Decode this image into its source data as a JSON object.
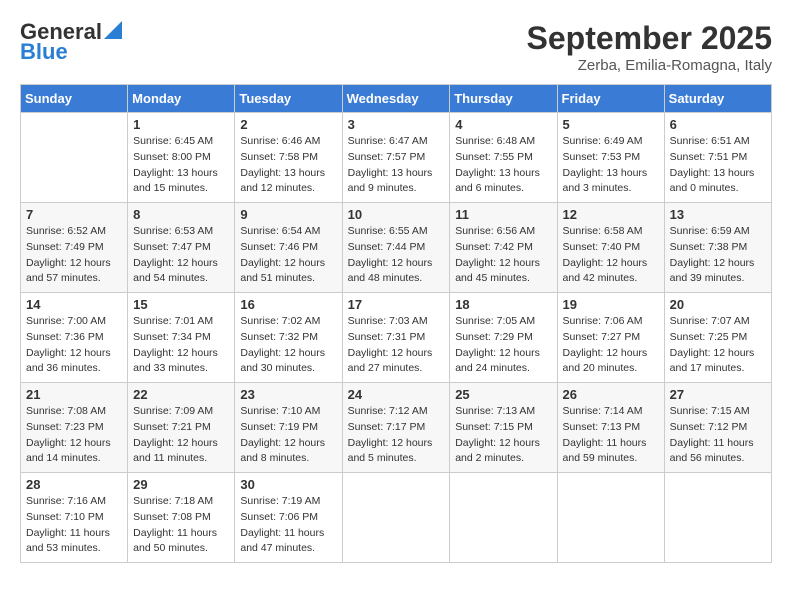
{
  "logo": {
    "general": "General",
    "blue": "Blue"
  },
  "title": {
    "month_year": "September 2025",
    "location": "Zerba, Emilia-Romagna, Italy"
  },
  "headers": [
    "Sunday",
    "Monday",
    "Tuesday",
    "Wednesday",
    "Thursday",
    "Friday",
    "Saturday"
  ],
  "weeks": [
    [
      {
        "day": "",
        "info": ""
      },
      {
        "day": "1",
        "info": "Sunrise: 6:45 AM\nSunset: 8:00 PM\nDaylight: 13 hours\nand 15 minutes."
      },
      {
        "day": "2",
        "info": "Sunrise: 6:46 AM\nSunset: 7:58 PM\nDaylight: 13 hours\nand 12 minutes."
      },
      {
        "day": "3",
        "info": "Sunrise: 6:47 AM\nSunset: 7:57 PM\nDaylight: 13 hours\nand 9 minutes."
      },
      {
        "day": "4",
        "info": "Sunrise: 6:48 AM\nSunset: 7:55 PM\nDaylight: 13 hours\nand 6 minutes."
      },
      {
        "day": "5",
        "info": "Sunrise: 6:49 AM\nSunset: 7:53 PM\nDaylight: 13 hours\nand 3 minutes."
      },
      {
        "day": "6",
        "info": "Sunrise: 6:51 AM\nSunset: 7:51 PM\nDaylight: 13 hours\nand 0 minutes."
      }
    ],
    [
      {
        "day": "7",
        "info": "Sunrise: 6:52 AM\nSunset: 7:49 PM\nDaylight: 12 hours\nand 57 minutes."
      },
      {
        "day": "8",
        "info": "Sunrise: 6:53 AM\nSunset: 7:47 PM\nDaylight: 12 hours\nand 54 minutes."
      },
      {
        "day": "9",
        "info": "Sunrise: 6:54 AM\nSunset: 7:46 PM\nDaylight: 12 hours\nand 51 minutes."
      },
      {
        "day": "10",
        "info": "Sunrise: 6:55 AM\nSunset: 7:44 PM\nDaylight: 12 hours\nand 48 minutes."
      },
      {
        "day": "11",
        "info": "Sunrise: 6:56 AM\nSunset: 7:42 PM\nDaylight: 12 hours\nand 45 minutes."
      },
      {
        "day": "12",
        "info": "Sunrise: 6:58 AM\nSunset: 7:40 PM\nDaylight: 12 hours\nand 42 minutes."
      },
      {
        "day": "13",
        "info": "Sunrise: 6:59 AM\nSunset: 7:38 PM\nDaylight: 12 hours\nand 39 minutes."
      }
    ],
    [
      {
        "day": "14",
        "info": "Sunrise: 7:00 AM\nSunset: 7:36 PM\nDaylight: 12 hours\nand 36 minutes."
      },
      {
        "day": "15",
        "info": "Sunrise: 7:01 AM\nSunset: 7:34 PM\nDaylight: 12 hours\nand 33 minutes."
      },
      {
        "day": "16",
        "info": "Sunrise: 7:02 AM\nSunset: 7:32 PM\nDaylight: 12 hours\nand 30 minutes."
      },
      {
        "day": "17",
        "info": "Sunrise: 7:03 AM\nSunset: 7:31 PM\nDaylight: 12 hours\nand 27 minutes."
      },
      {
        "day": "18",
        "info": "Sunrise: 7:05 AM\nSunset: 7:29 PM\nDaylight: 12 hours\nand 24 minutes."
      },
      {
        "day": "19",
        "info": "Sunrise: 7:06 AM\nSunset: 7:27 PM\nDaylight: 12 hours\nand 20 minutes."
      },
      {
        "day": "20",
        "info": "Sunrise: 7:07 AM\nSunset: 7:25 PM\nDaylight: 12 hours\nand 17 minutes."
      }
    ],
    [
      {
        "day": "21",
        "info": "Sunrise: 7:08 AM\nSunset: 7:23 PM\nDaylight: 12 hours\nand 14 minutes."
      },
      {
        "day": "22",
        "info": "Sunrise: 7:09 AM\nSunset: 7:21 PM\nDaylight: 12 hours\nand 11 minutes."
      },
      {
        "day": "23",
        "info": "Sunrise: 7:10 AM\nSunset: 7:19 PM\nDaylight: 12 hours\nand 8 minutes."
      },
      {
        "day": "24",
        "info": "Sunrise: 7:12 AM\nSunset: 7:17 PM\nDaylight: 12 hours\nand 5 minutes."
      },
      {
        "day": "25",
        "info": "Sunrise: 7:13 AM\nSunset: 7:15 PM\nDaylight: 12 hours\nand 2 minutes."
      },
      {
        "day": "26",
        "info": "Sunrise: 7:14 AM\nSunset: 7:13 PM\nDaylight: 11 hours\nand 59 minutes."
      },
      {
        "day": "27",
        "info": "Sunrise: 7:15 AM\nSunset: 7:12 PM\nDaylight: 11 hours\nand 56 minutes."
      }
    ],
    [
      {
        "day": "28",
        "info": "Sunrise: 7:16 AM\nSunset: 7:10 PM\nDaylight: 11 hours\nand 53 minutes."
      },
      {
        "day": "29",
        "info": "Sunrise: 7:18 AM\nSunset: 7:08 PM\nDaylight: 11 hours\nand 50 minutes."
      },
      {
        "day": "30",
        "info": "Sunrise: 7:19 AM\nSunset: 7:06 PM\nDaylight: 11 hours\nand 47 minutes."
      },
      {
        "day": "",
        "info": ""
      },
      {
        "day": "",
        "info": ""
      },
      {
        "day": "",
        "info": ""
      },
      {
        "day": "",
        "info": ""
      }
    ]
  ]
}
